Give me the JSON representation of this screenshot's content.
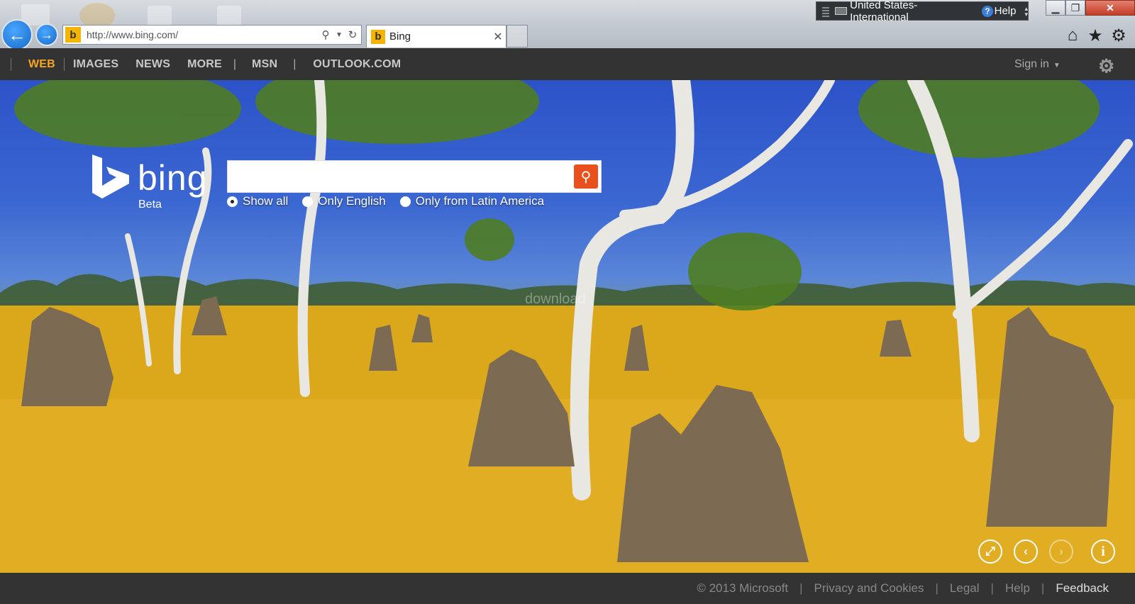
{
  "browser": {
    "address_url": "http://www.bing.com/",
    "tab_title": "Bing",
    "language_bar": {
      "language": "United States-International",
      "help_label": "Help"
    },
    "window_controls": [
      "minimize",
      "maximize",
      "close"
    ],
    "toolbar_icons": [
      "home-icon",
      "star-icon",
      "gear-icon"
    ]
  },
  "bing_header": {
    "nav": [
      {
        "label": "WEB",
        "active": true
      },
      {
        "label": "IMAGES"
      },
      {
        "label": "NEWS"
      },
      {
        "label": "MORE"
      },
      {
        "label": "MSN"
      },
      {
        "label": "OUTLOOK.COM"
      }
    ],
    "signin_label": "Sign in"
  },
  "search": {
    "logo_text": "bing",
    "logo_sub": "Beta",
    "input_value": "",
    "filters": [
      {
        "label": "Show all",
        "checked": true
      },
      {
        "label": "Only English",
        "checked": false
      },
      {
        "label": "Only from Latin America",
        "checked": false
      }
    ]
  },
  "image_controls": [
    {
      "name": "fullscreen-icon",
      "glyph": "⤢"
    },
    {
      "name": "previous-image-icon",
      "glyph": "‹"
    },
    {
      "name": "next-image-icon",
      "glyph": "›",
      "disabled": true
    },
    {
      "name": "info-icon",
      "glyph": "i"
    }
  ],
  "footer": {
    "copyright": "© 2013 Microsoft",
    "links": [
      "Privacy and Cookies",
      "Legal",
      "Help",
      "Feedback"
    ]
  },
  "colors": {
    "accent": "#f5a623",
    "search_button": "#e8501d",
    "header_bg": "#333333"
  }
}
